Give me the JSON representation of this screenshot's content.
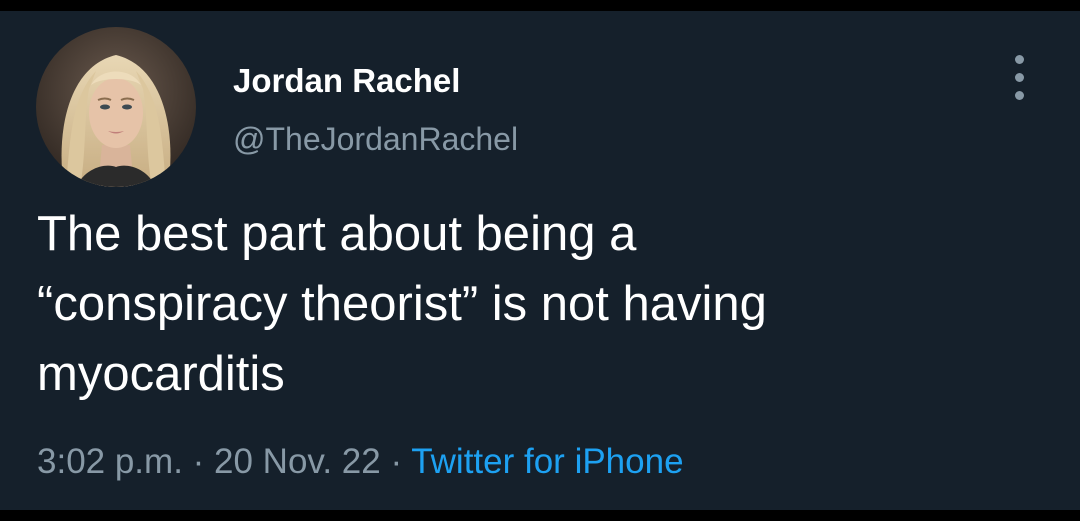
{
  "tweet": {
    "author": {
      "display_name": "Jordan Rachel",
      "handle": "@TheJordanRachel"
    },
    "text_lines": [
      "The best part about being a",
      "“conspiracy theorist” is not having",
      "myocarditis"
    ],
    "meta": {
      "time": "3:02 p.m.",
      "separator": " · ",
      "date": "20 Nov. 22",
      "source": "Twitter for iPhone"
    },
    "icons": {
      "more": "more-vertical-icon",
      "avatar": "profile-photo"
    },
    "colors": {
      "background": "#15202b",
      "text": "#ffffff",
      "secondary_text": "#8899a6",
      "link": "#1da1f2"
    }
  }
}
